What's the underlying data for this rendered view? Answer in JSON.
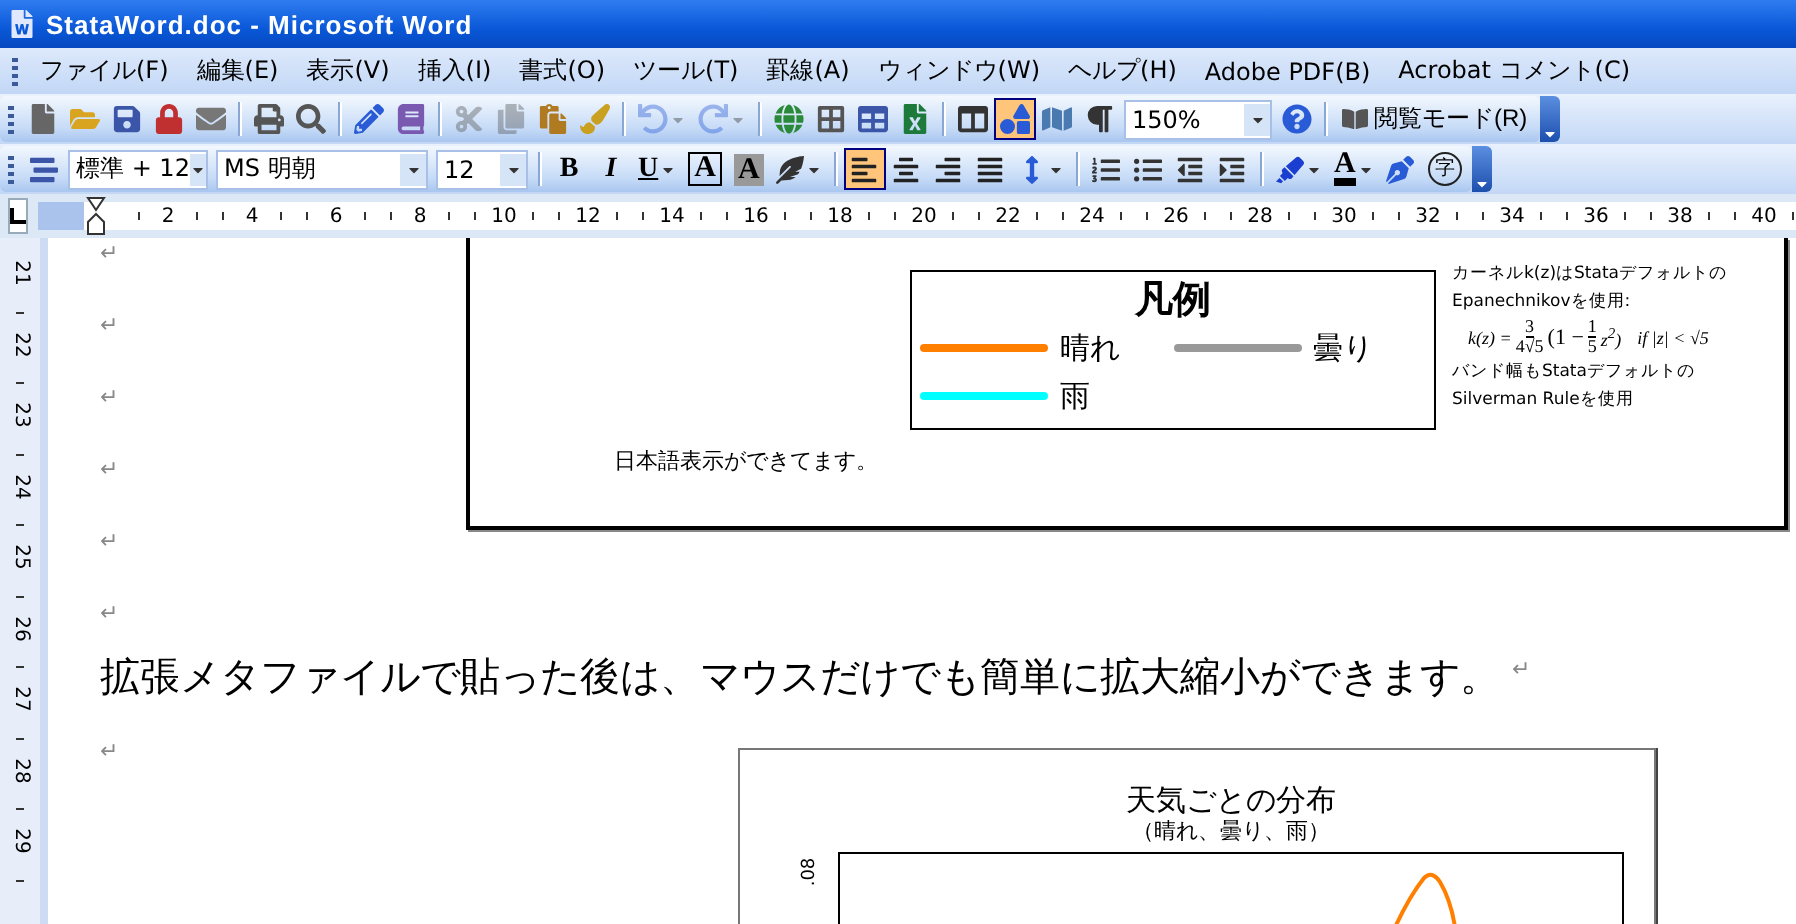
{
  "window": {
    "title": "StataWord.doc - Microsoft Word"
  },
  "menu": [
    "ファイル(F)",
    "編集(E)",
    "表示(V)",
    "挿入(I)",
    "書式(O)",
    "ツール(T)",
    "罫線(A)",
    "ウィンドウ(W)",
    "ヘルプ(H)",
    "Adobe PDF(B)",
    "Acrobat コメント(C)"
  ],
  "standard_toolbar": {
    "buttons": [
      {
        "selected": false,
        "disabled": false
      },
      {
        "selected": false,
        "disabled": false
      },
      {
        "selected": false,
        "disabled": false
      },
      {
        "selected": false,
        "disabled": false
      },
      {
        "selected": false,
        "disabled": false
      },
      {
        "selected": false,
        "disabled": false
      },
      {
        "selected": false,
        "disabled": false
      },
      {
        "selected": false,
        "disabled": false
      },
      {
        "selected": false,
        "disabled": false
      },
      {
        "selected": false,
        "disabled": true
      },
      {
        "selected": false,
        "disabled": true
      },
      {
        "selected": false,
        "disabled": false
      },
      {
        "selected": false,
        "disabled": false
      },
      {
        "selected": false,
        "disabled": true
      },
      {
        "selected": false,
        "disabled": true
      },
      {
        "selected": false,
        "disabled": false
      },
      {
        "selected": false,
        "disabled": false
      },
      {
        "selected": false,
        "disabled": false
      },
      {
        "selected": false,
        "disabled": false
      },
      {
        "selected": false,
        "disabled": false
      },
      {
        "selected": true,
        "disabled": false
      },
      {
        "selected": false,
        "disabled": false
      },
      {
        "selected": false,
        "disabled": false
      },
      {
        "selected": false,
        "disabled": false
      }
    ],
    "zoom": "150%",
    "reading_mode": "閲覧モード(R)"
  },
  "formatting_toolbar": {
    "style": "標準 + 12",
    "font": "MS 明朝",
    "size": "12",
    "buttons": [
      {
        "kind": "text",
        "label": "B",
        "selected": false
      },
      {
        "kind": "text",
        "label": "I",
        "selected": false
      },
      {
        "kind": "text",
        "label": "U",
        "selected": false
      },
      {
        "kind": "text",
        "label": "A",
        "selected": false
      },
      {
        "kind": "text",
        "label": "A",
        "selected": false
      },
      {
        "kind": "icon",
        "selected": false
      },
      {
        "kind": "icon",
        "selected": true
      },
      {
        "kind": "icon",
        "selected": false
      },
      {
        "kind": "icon",
        "selected": false
      },
      {
        "kind": "icon",
        "selected": false
      },
      {
        "kind": "icon",
        "selected": false
      },
      {
        "kind": "icon",
        "selected": false
      },
      {
        "kind": "icon",
        "selected": false
      },
      {
        "kind": "icon",
        "selected": false
      },
      {
        "kind": "icon",
        "selected": false
      },
      {
        "kind": "icon",
        "selected": false
      },
      {
        "kind": "text",
        "label": "A",
        "selected": false
      },
      {
        "kind": "icon",
        "selected": false
      },
      {
        "kind": "text",
        "label": "字",
        "selected": false
      }
    ]
  },
  "ruler": {
    "labels": [
      "2",
      "4",
      "6",
      "8",
      "10",
      "12",
      "14",
      "16",
      "18",
      "20",
      "22",
      "24",
      "26",
      "28",
      "30",
      "32",
      "34",
      "36",
      "38",
      "40"
    ]
  },
  "vertical_ruler": {
    "labels": [
      "21",
      "22",
      "23",
      "24",
      "25",
      "26",
      "27",
      "28",
      "29"
    ]
  },
  "document": {
    "paragraph_marks_top": [
      "↵",
      "↵",
      "↵",
      "↵",
      "↵",
      "↵"
    ],
    "figure1": {
      "legend": {
        "title": "凡例",
        "entries": [
          {
            "label": "晴れ",
            "color": "#ff7f00"
          },
          {
            "label": "曇り",
            "color": "#999999"
          },
          {
            "label": "雨",
            "color": "#00ffff"
          }
        ]
      },
      "note": {
        "lines_before": [
          "カーネルk(z)はStataデフォルトの",
          "Epanechnikovを使用:"
        ],
        "formula": {
          "lhs": "k(z) =",
          "coef_num": "3",
          "coef_den": "4√5",
          "open": "(1 −",
          "inner_num": "1",
          "inner_den": "5",
          "tail": "z$^{2}$)",
          "condition": "if |z| < √5"
        },
        "lines_after": [
          "バンド幅もStataデフォルトの",
          "Silverman Ruleを使用"
        ]
      },
      "caption": "日本語表示ができてます。"
    },
    "sentence": {
      "text": "拡張メタファイルで貼った後は、マウスだけでも簡単に拡大縮小ができます。",
      "mark": "↵"
    },
    "paragraph_mark": "↵",
    "figure2": {
      "title": "天気ごとの分布",
      "subtitle": "（晴れ、曇り、雨）",
      "y_tick": ".08"
    }
  }
}
